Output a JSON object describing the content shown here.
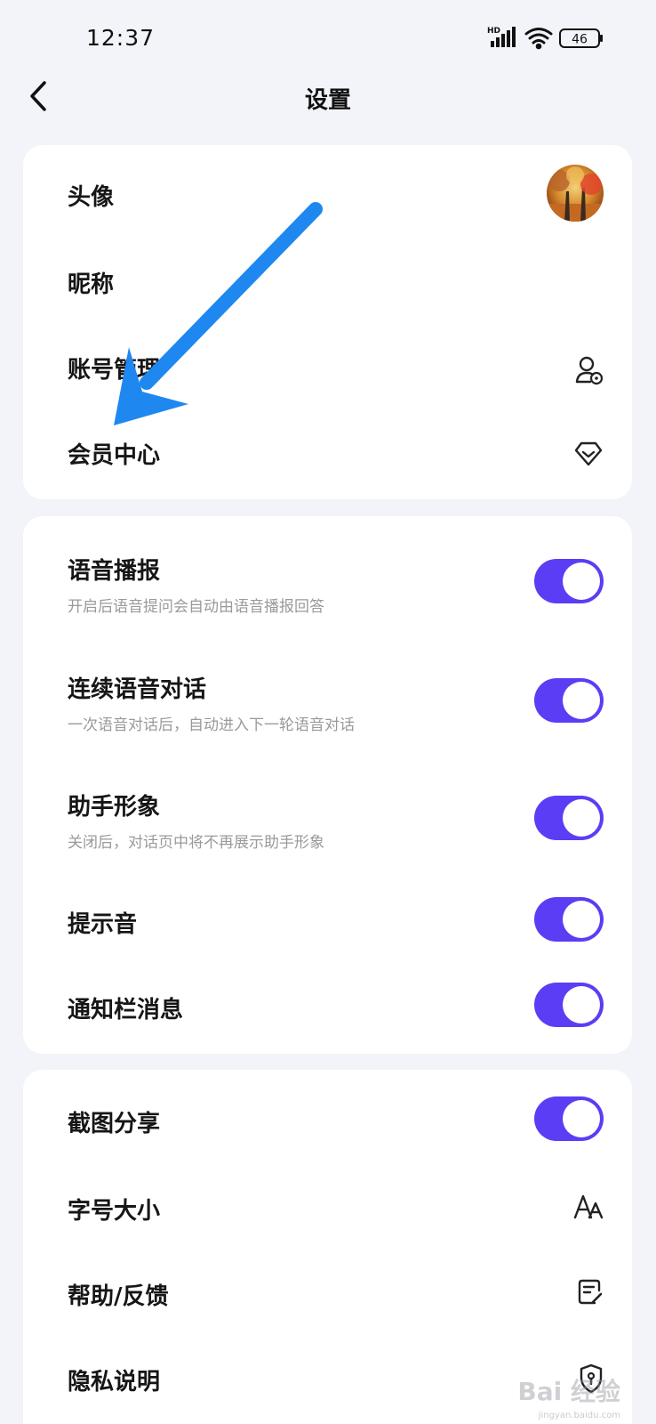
{
  "status_bar": {
    "time": "12:37",
    "network_label": "HD",
    "battery_level": "46"
  },
  "header": {
    "title": "设置"
  },
  "account_section": {
    "items": [
      {
        "label": "头像",
        "right": "avatar"
      },
      {
        "label": "昵称",
        "right": ""
      },
      {
        "label": "账号管理",
        "right": "account-manage-icon"
      },
      {
        "label": "会员中心",
        "right": "diamond-icon"
      }
    ]
  },
  "voice_section": {
    "items": [
      {
        "label": "语音播报",
        "description": "开启后语音提问会自动由语音播报回答",
        "toggle": true
      },
      {
        "label": "连续语音对话",
        "description": "一次语音对话后，自动进入下一轮语音对话",
        "toggle": true
      },
      {
        "label": "助手形象",
        "description": "关闭后，对话页中将不再展示助手形象",
        "toggle": true
      },
      {
        "label": "提示音",
        "toggle": true
      },
      {
        "label": "通知栏消息",
        "toggle": true
      }
    ]
  },
  "general_section": {
    "items": [
      {
        "label": "截图分享",
        "toggle": true
      },
      {
        "label": "字号大小",
        "right": "font-size-icon"
      },
      {
        "label": "帮助/反馈",
        "right": "feedback-icon"
      },
      {
        "label": "隐私说明",
        "right": "shield-icon"
      }
    ]
  },
  "annotation": {
    "arrow_color": "#1e88f0"
  },
  "colors": {
    "background": "#f3f4f9",
    "card": "#ffffff",
    "toggle_on": "#5b3df5",
    "description": "#9a9a9a"
  },
  "watermark": {
    "text": "Bai 经验",
    "sub": "jingyan.baidu.com"
  }
}
